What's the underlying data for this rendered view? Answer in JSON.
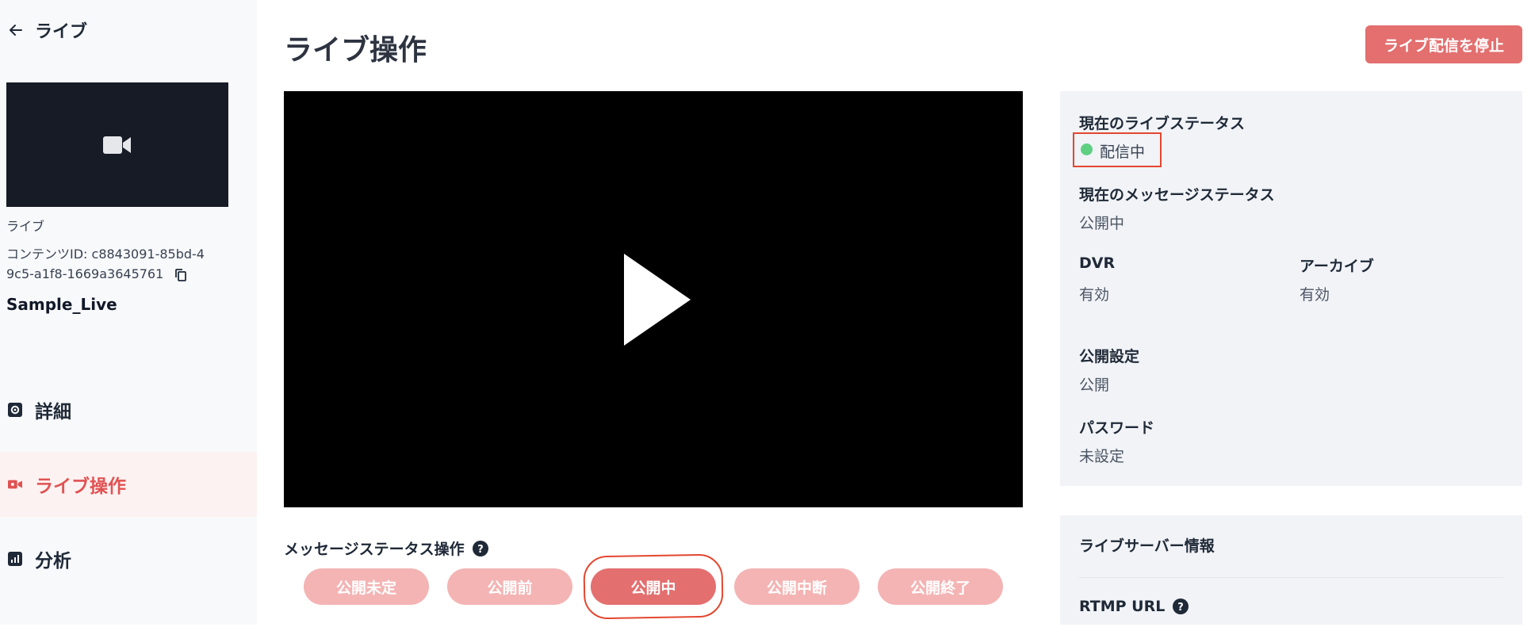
{
  "sidebar": {
    "back_label": "ライブ",
    "content_type": "ライブ",
    "content_id": "コンテンツID: c8843091-85bd-49c5-a1f8-1669a3645761",
    "content_name": "Sample_Live",
    "nav": [
      {
        "label": "詳細",
        "icon": "settings-icon"
      },
      {
        "label": "ライブ操作",
        "icon": "video-icon",
        "active": true
      },
      {
        "label": "分析",
        "icon": "chart-icon"
      }
    ]
  },
  "header": {
    "title": "ライブ操作",
    "stop_button": "ライブ配信を停止"
  },
  "player": {
    "icon": "play-icon"
  },
  "message_ops": {
    "title": "メッセージステータス操作",
    "buttons": [
      {
        "label": "公開未定"
      },
      {
        "label": "公開前"
      },
      {
        "label": "公開中",
        "active": true
      },
      {
        "label": "公開中断"
      },
      {
        "label": "公開終了"
      }
    ]
  },
  "status_panel": {
    "live_status_label": "現在のライブステータス",
    "live_status_value": "配信中",
    "message_status_label": "現在のメッセージステータス",
    "message_status_value": "公開中",
    "dvr_label": "DVR",
    "dvr_value": "有効",
    "archive_label": "アーカイブ",
    "archive_value": "有効",
    "visibility_label": "公開設定",
    "visibility_value": "公開",
    "password_label": "パスワード",
    "password_value": "未設定"
  },
  "server_panel": {
    "title": "ライブサーバー情報",
    "rtmp_label": "RTMP URL"
  },
  "colors": {
    "accent": "#e36f6f",
    "accent_light": "#f4b4b4",
    "live_dot": "#5fcf82",
    "annotation": "#e3472f"
  }
}
